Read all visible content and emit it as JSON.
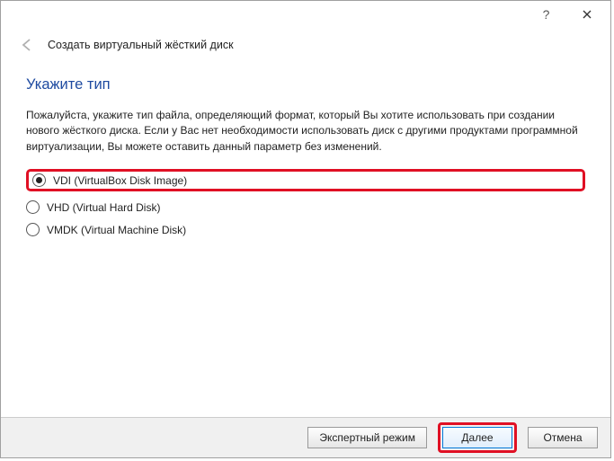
{
  "titlebar": {
    "help": "?",
    "close": "×"
  },
  "header": {
    "title": "Создать виртуальный жёсткий диск"
  },
  "content": {
    "section_title": "Укажите тип",
    "description": "Пожалуйста, укажите тип файла, определяющий формат, который Вы хотите использовать при создании нового жёсткого диска. Если у Вас нет необходимости использовать диск с другими продуктами программной виртуализации, Вы можете оставить данный параметр без изменений.",
    "options": [
      {
        "label": "VDI (VirtualBox Disk Image)",
        "selected": true
      },
      {
        "label": "VHD (Virtual Hard Disk)",
        "selected": false
      },
      {
        "label": "VMDK (Virtual Machine Disk)",
        "selected": false
      }
    ]
  },
  "buttons": {
    "expert": "Экспертный режим",
    "next": "Далее",
    "cancel": "Отмена"
  }
}
